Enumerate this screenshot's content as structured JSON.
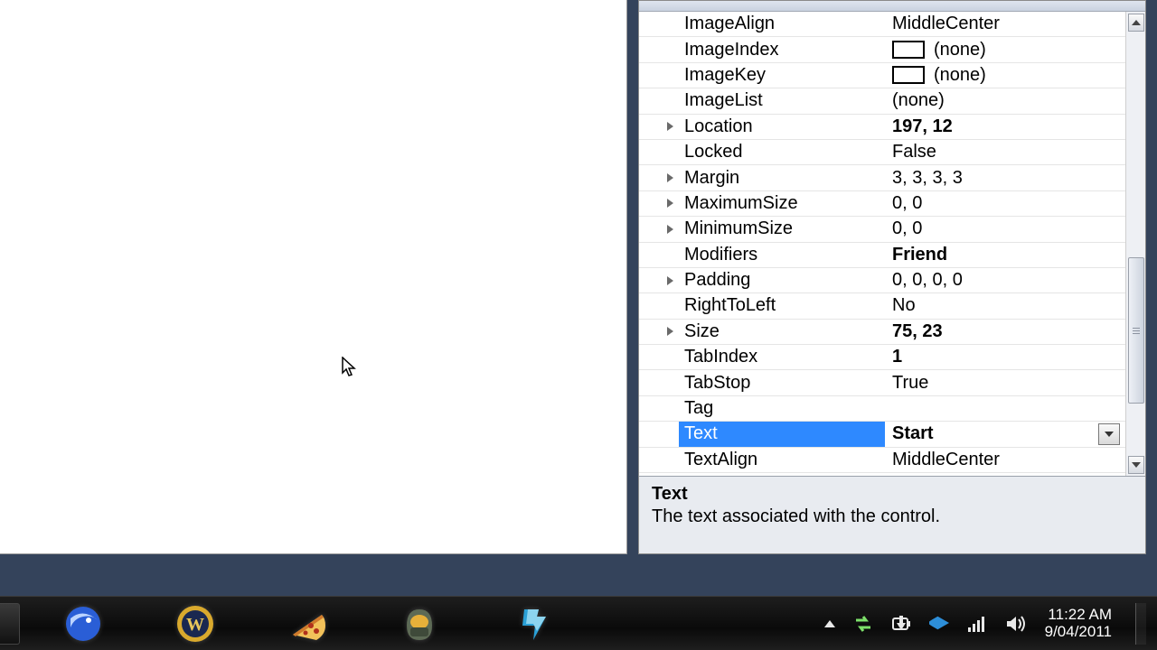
{
  "properties": [
    {
      "name": "ImageAlign",
      "value": "MiddleCenter",
      "bold": false,
      "expand": false,
      "swatch": false
    },
    {
      "name": "ImageIndex",
      "value": "(none)",
      "bold": false,
      "expand": false,
      "swatch": true
    },
    {
      "name": "ImageKey",
      "value": "(none)",
      "bold": false,
      "expand": false,
      "swatch": true
    },
    {
      "name": "ImageList",
      "value": "(none)",
      "bold": false,
      "expand": false,
      "swatch": false
    },
    {
      "name": "Location",
      "value": "197, 12",
      "bold": true,
      "expand": true,
      "swatch": false
    },
    {
      "name": "Locked",
      "value": "False",
      "bold": false,
      "expand": false,
      "swatch": false
    },
    {
      "name": "Margin",
      "value": "3, 3, 3, 3",
      "bold": false,
      "expand": true,
      "swatch": false
    },
    {
      "name": "MaximumSize",
      "value": "0, 0",
      "bold": false,
      "expand": true,
      "swatch": false
    },
    {
      "name": "MinimumSize",
      "value": "0, 0",
      "bold": false,
      "expand": true,
      "swatch": false
    },
    {
      "name": "Modifiers",
      "value": "Friend",
      "bold": true,
      "expand": false,
      "swatch": false
    },
    {
      "name": "Padding",
      "value": "0, 0, 0, 0",
      "bold": false,
      "expand": true,
      "swatch": false
    },
    {
      "name": "RightToLeft",
      "value": "No",
      "bold": false,
      "expand": false,
      "swatch": false
    },
    {
      "name": "Size",
      "value": "75, 23",
      "bold": true,
      "expand": true,
      "swatch": false
    },
    {
      "name": "TabIndex",
      "value": "1",
      "bold": true,
      "expand": false,
      "swatch": false
    },
    {
      "name": "TabStop",
      "value": "True",
      "bold": false,
      "expand": false,
      "swatch": false
    },
    {
      "name": "Tag",
      "value": "",
      "bold": false,
      "expand": false,
      "swatch": false
    },
    {
      "name": "Text",
      "value": "Start",
      "bold": true,
      "expand": false,
      "swatch": false,
      "selected": true,
      "dropdown": true
    },
    {
      "name": "TextAlign",
      "value": "MiddleCenter",
      "bold": false,
      "expand": false,
      "swatch": false
    }
  ],
  "description": {
    "title": "Text",
    "body": "The text associated with the control."
  },
  "taskbar": {
    "icons": [
      "thunderbird-icon",
      "wow-icon",
      "pizza-icon",
      "halo-icon",
      "starcraft-icon"
    ]
  },
  "systray": {
    "time": "11:22 AM",
    "date": "9/04/2011"
  }
}
